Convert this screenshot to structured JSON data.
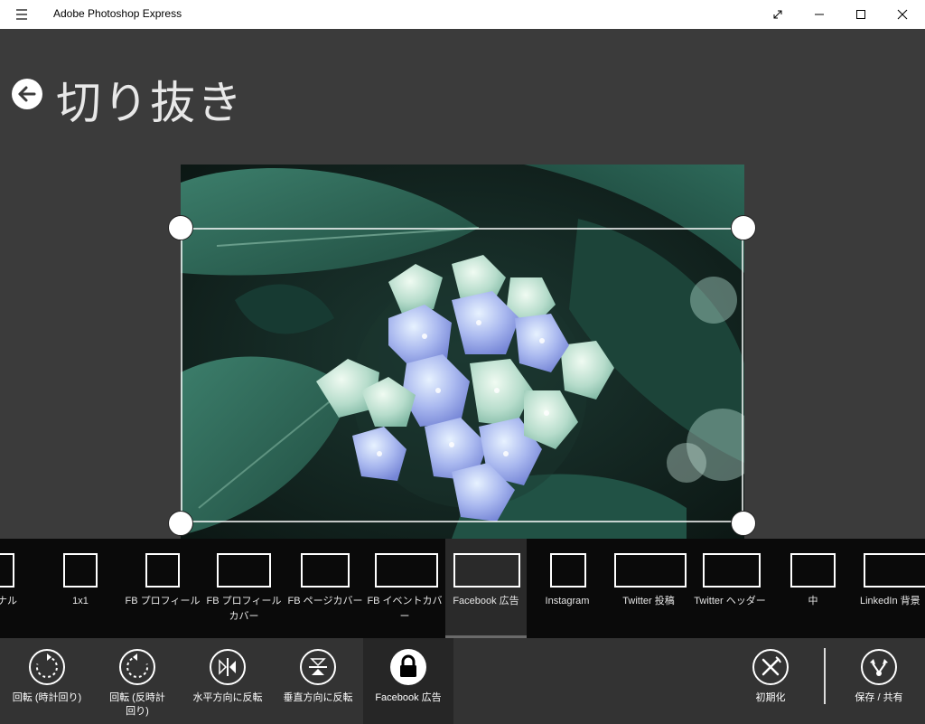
{
  "window": {
    "title": "Adobe Photoshop Express",
    "menu_icon": "hamburger-icon",
    "controls": [
      "expand-icon",
      "minimize-icon",
      "maximize-icon",
      "close-icon"
    ]
  },
  "page": {
    "title": "切り抜き",
    "back_icon": "back-arrow-icon"
  },
  "image": {
    "description_icon": "photo"
  },
  "presets": [
    {
      "id": "original",
      "label": "ナル",
      "selected": false
    },
    {
      "id": "1x1",
      "label": "1x1",
      "selected": false
    },
    {
      "id": "fb-profile",
      "label": "FB プロフィール",
      "selected": false
    },
    {
      "id": "fb-profile-cover",
      "label": "FB プロフィールカバー",
      "selected": false
    },
    {
      "id": "fb-page-cover",
      "label": "FB ページカバー",
      "selected": false
    },
    {
      "id": "fb-event-cover",
      "label": "FB イベントカバー",
      "selected": false
    },
    {
      "id": "facebook-ad",
      "label": "Facebook 広告",
      "selected": true
    },
    {
      "id": "instagram",
      "label": "Instagram",
      "selected": false
    },
    {
      "id": "twitter-post",
      "label": "Twitter 投稿",
      "selected": false
    },
    {
      "id": "twitter-header",
      "label": "Twitter ヘッダー",
      "selected": false
    },
    {
      "id": "medium",
      "label": "中",
      "selected": false
    },
    {
      "id": "linkedin-bg",
      "label": "LinkedIn 背景",
      "selected": false
    }
  ],
  "toolbar": {
    "rotate_cw": "回転 (時計回り)",
    "rotate_ccw": "回転 (反時計回り)",
    "flip_h": "水平方向に反転",
    "flip_v": "垂直方向に反転",
    "lock": "Facebook 広告",
    "reset": "初期化",
    "save_share": "保存 / 共有"
  },
  "colors": {
    "background": "#3b3b3b",
    "titlebar": "#ffffff",
    "preset_strip": "#0f0f0f",
    "toolbar": "#333333",
    "accent_white": "#ffffff"
  }
}
